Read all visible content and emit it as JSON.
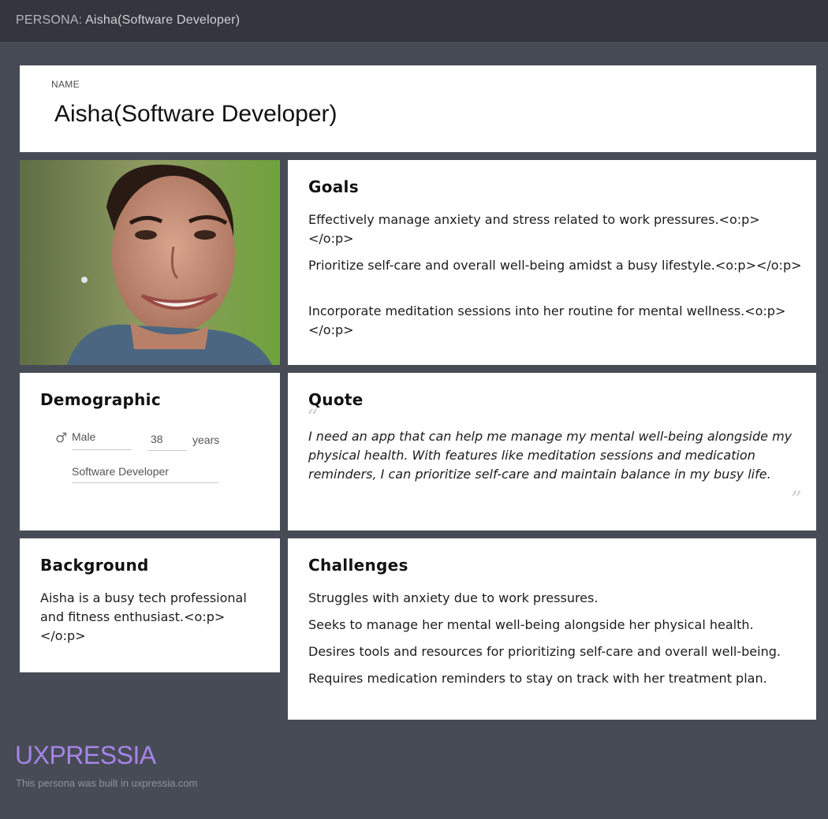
{
  "header": {
    "prefix": "PERSONA:",
    "persona_name": "Aisha(Software Developer)"
  },
  "name_card": {
    "label": "NAME",
    "value": "Aisha(Software Developer)"
  },
  "photo": {
    "alt": "portrait photo"
  },
  "goals": {
    "title": "Goals",
    "items": [
      "Effectively manage anxiety and stress related to work pressures.<o:p></o:p>",
      "Prioritize self-care and overall well-being amidst a busy lifestyle.<o:p></o:p>",
      "Incorporate meditation sessions into her routine for mental wellness.<o:p></o:p>"
    ]
  },
  "demographic": {
    "title": "Demographic",
    "gender_icon": "male-icon",
    "gender": "Male",
    "age": "38",
    "age_unit": "years",
    "occupation": "Software Developer"
  },
  "quote": {
    "title": "Quote",
    "open_mark": "“",
    "close_mark": "”",
    "text": "I need an app that can help me manage my mental well-being alongside my physical health. With features like meditation sessions and medication reminders, I can prioritize self-care and maintain balance in my busy life."
  },
  "background": {
    "title": "Background",
    "text": "Aisha is a busy tech professional and fitness enthusiast.<o:p></o:p>"
  },
  "challenges": {
    "title": "Challenges",
    "items": [
      "Struggles with anxiety due to work pressures.",
      "Seeks to manage her mental well-being alongside her physical health.",
      "Desires tools and resources for prioritizing self-care and overall well-being.",
      "Requires medication reminders to stay on track with her treatment plan."
    ]
  },
  "footer": {
    "brand": "UXPRESSIA",
    "note": "This persona was built in uxpressia.com"
  }
}
